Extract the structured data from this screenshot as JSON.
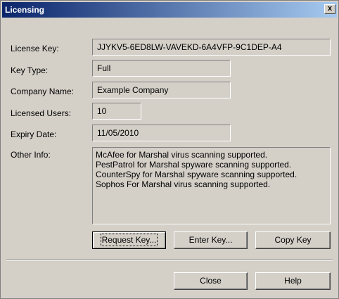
{
  "window": {
    "title": "Licensing",
    "close_glyph": "x"
  },
  "fields": {
    "license_key": {
      "label": "License Key:",
      "value": "JJYKV5-6ED8LW-VAVEKD-6A4VFP-9C1DEP-A4"
    },
    "key_type": {
      "label": "Key Type:",
      "value": "Full"
    },
    "company_name": {
      "label": "Company Name:",
      "value": "Example Company"
    },
    "licensed_users": {
      "label": "Licensed Users:",
      "value": "10"
    },
    "expiry_date": {
      "label": "Expiry Date:",
      "value": "11/05/2010"
    },
    "other_info": {
      "label": "Other Info:",
      "lines": [
        "McAfee for Marshal virus scanning supported.",
        "PestPatrol for Marshal spyware scanning supported.",
        "CounterSpy for Marshal spyware scanning supported.",
        "Sophos For Marshal virus scanning supported."
      ]
    }
  },
  "buttons": {
    "request_key": "Request Key...",
    "enter_key": "Enter Key...",
    "copy_key": "Copy Key",
    "close": "Close",
    "help": "Help"
  }
}
